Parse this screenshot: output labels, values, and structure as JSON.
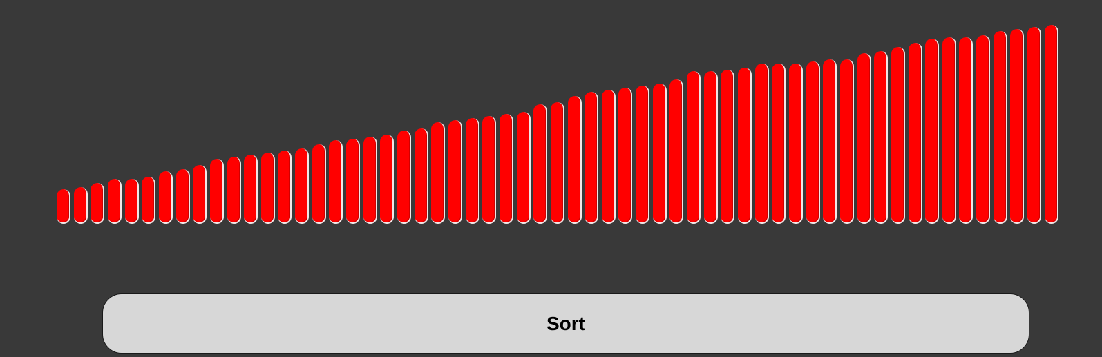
{
  "controls": {
    "sort_label": "Sort"
  },
  "colors": {
    "background": "#393939",
    "bar_fill": "#ff0000",
    "bar_highlight": "#f2e6e6",
    "button_bg": "#d7d7d7",
    "button_text": "#000000"
  },
  "bars": {
    "max_value": 100,
    "values": [
      17,
      18,
      20,
      22,
      22,
      23,
      26,
      27,
      29,
      32,
      33,
      34,
      35,
      36,
      37,
      39,
      41,
      42,
      43,
      44,
      46,
      47,
      50,
      51,
      52,
      53,
      54,
      55,
      59,
      60,
      63,
      65,
      66,
      67,
      68,
      69,
      71,
      75,
      75,
      76,
      77,
      79,
      79,
      79,
      80,
      81,
      81,
      84,
      85,
      87,
      89,
      91,
      92,
      92,
      93,
      95,
      96,
      97,
      98
    ]
  }
}
